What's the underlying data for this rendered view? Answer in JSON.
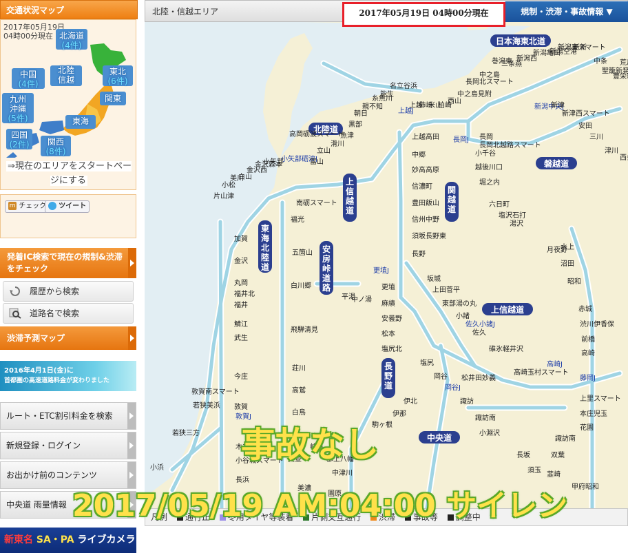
{
  "sidebar": {
    "header": "交通状況マップ",
    "area_date": "2017年05月19日",
    "area_time": "04時00分現在",
    "regions": [
      {
        "name": "北海道",
        "count": "(4件)"
      },
      {
        "name": "北陸信越",
        "count": ""
      },
      {
        "name": "中国",
        "count": "(4件)"
      },
      {
        "name": "東北",
        "count": "(6件)"
      },
      {
        "name": "関東",
        "count": ""
      },
      {
        "name": "九州沖縄",
        "count": "(5件)"
      },
      {
        "name": "東海",
        "count": ""
      },
      {
        "name": "四国",
        "count": "(2件)"
      },
      {
        "name": "関西",
        "count": "(8件)"
      }
    ],
    "start_link": "⇒現在のエリアをスタートページにする",
    "check_label": "チェック",
    "tweet_label": "ツイート",
    "ic_search_header": "発着IC検索で現在の規制&渋滞をチェック",
    "history_search": "履歴から検索",
    "road_search": "道路名で検索",
    "jam_forecast": "渋滞予測マップ",
    "banner_line1": "2016年4月1日(金)に",
    "banner_line2": "首都圏の高速道路料金が変わりました",
    "menu": [
      "ルート・ETC割引料金を検索",
      "新規登録・ログイン",
      "お出かけ前のコンテンツ",
      "中央道 雨量情報"
    ],
    "live_camera_red": "新東名",
    "live_camera_yellow": "SA・PA",
    "live_camera_white": "ライブカメラ"
  },
  "map": {
    "area_title": "北陸・信越エリア",
    "timestamp": "2017年05月19日 04時00分現在",
    "info_button": "規制・渋滞・事故情報 ▼",
    "colors": {
      "sea": "#e2eef3",
      "land": "#f5f0d6",
      "road": "#9fd4e4",
      "road_edge": "#ffffff"
    },
    "roads": [
      {
        "name": "日本海東北道"
      },
      {
        "name": "北陸道"
      },
      {
        "name": "磐越道"
      },
      {
        "name": "関越道"
      },
      {
        "name": "上信越道"
      },
      {
        "name": "東海北陸道"
      },
      {
        "name": "安房峠道路"
      },
      {
        "name": "長野道"
      },
      {
        "name": "中央道"
      }
    ],
    "legend": [
      {
        "label": "凡例",
        "color": ""
      },
      {
        "label": "通行止",
        "color": "#222222"
      },
      {
        "label": "冬用タイヤ等装着",
        "color": "#9b8fe8"
      },
      {
        "label": "片側交互通行",
        "color": "#2f7a2f"
      },
      {
        "label": "渋滞",
        "color": "#f08a1c"
      },
      {
        "label": "事故等",
        "color": "#222222"
      },
      {
        "label": "調整中",
        "color": "#222222"
      }
    ]
  },
  "overlay": {
    "status": "事故なし",
    "caption": "2017/05/19 AM:04:00 サイレン"
  }
}
